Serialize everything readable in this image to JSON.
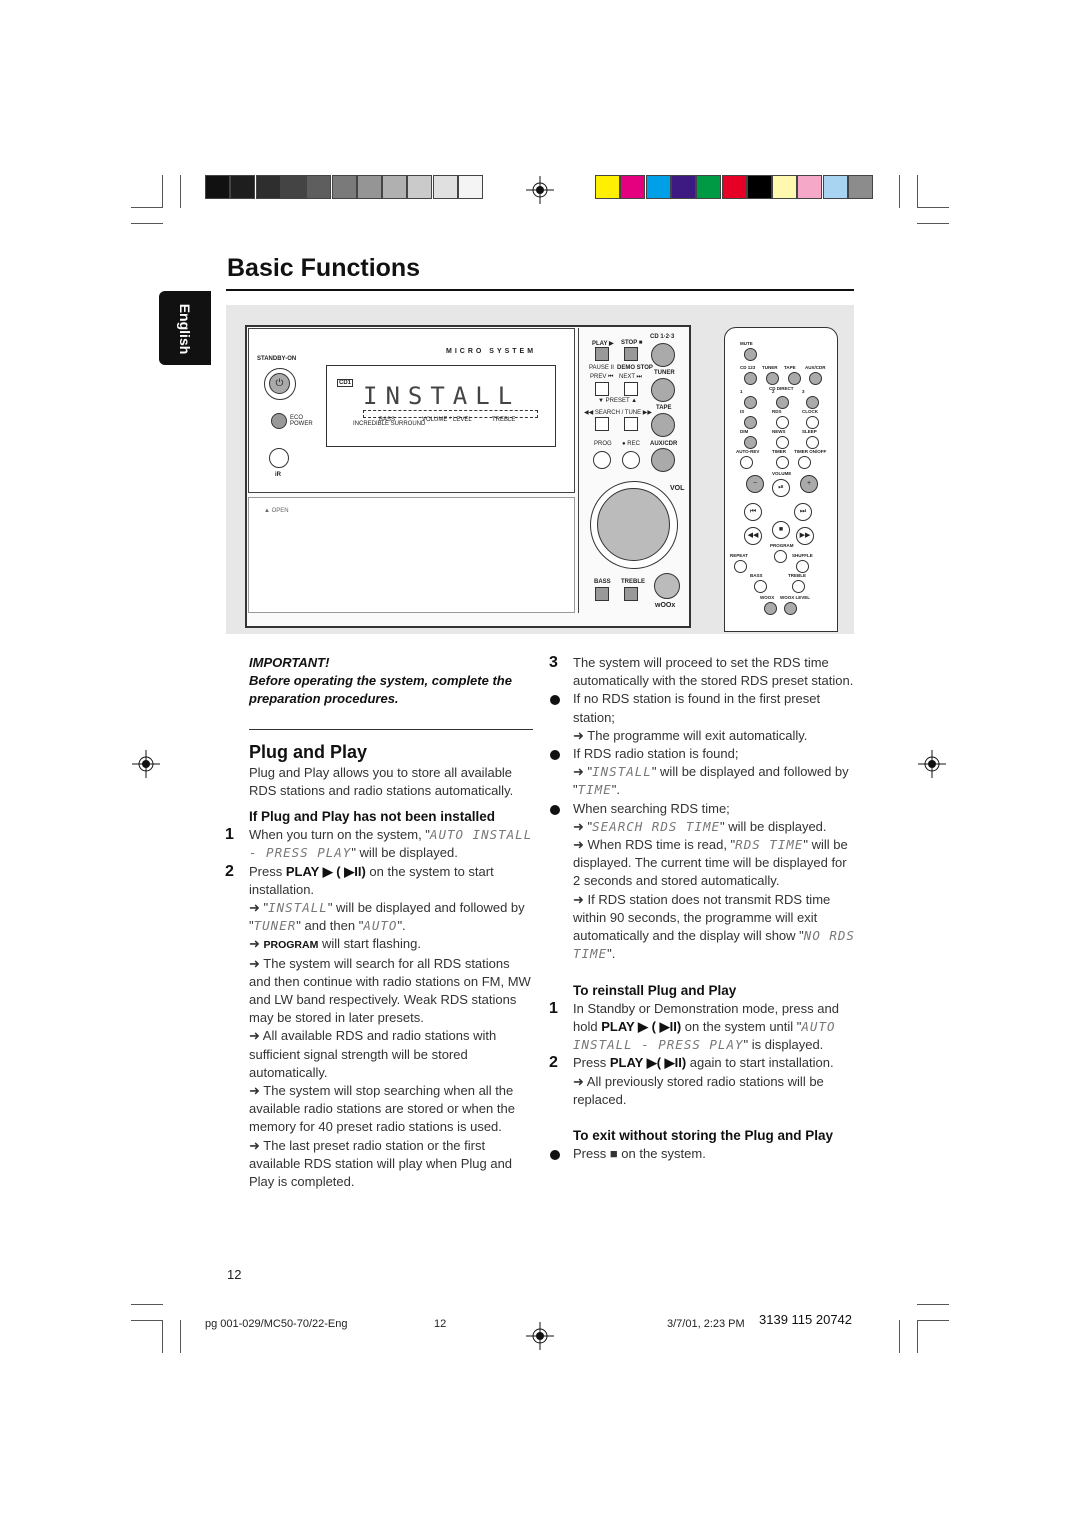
{
  "colors": {
    "grays": [
      "#111111",
      "#1e1e1e",
      "#2e2e2e",
      "#444444",
      "#5e5e5e",
      "#7a7a7a",
      "#959595",
      "#b0b0b0",
      "#cacaca",
      "#e0e0e0",
      "#f4f4f4"
    ],
    "process": [
      "#ffef00",
      "#e4007f",
      "#00a0e9",
      "#3c1a82",
      "#009944",
      "#e60026",
      "#000000",
      "#fff9b0",
      "#f5a8c8",
      "#a8d4f2",
      "#8c8c8c"
    ]
  },
  "page": {
    "title": "Basic Functions",
    "language_tab": "English",
    "page_number": "12"
  },
  "illustration": {
    "unit": {
      "brand_line": "MICRO SYSTEM",
      "standby": "STANDBY-ON",
      "eco": "ECO POWER",
      "ir": "iR",
      "open": "▲ OPEN",
      "display": {
        "text": "INSTALL",
        "cd": "CD1",
        "top_labels": [
          "OS",
          "DIM",
          "3",
          "FM",
          "CD",
          "RDS"
        ],
        "bass": "BASS",
        "surround": "INCREDIBLE SURROUND",
        "volume": "VOLUME * LEVEL",
        "treble": "TREBLE"
      },
      "controls": {
        "play": "PLAY ▶",
        "stop": "STOP ■",
        "cd123": "CD 1·2·3",
        "pause": "PAUSE II",
        "demo": "DEMO STOP",
        "tuner": "TUNER",
        "prev": "PREV ⏮",
        "next": "NEXT ⏭",
        "preset": "▼ PRESET ▲",
        "search": "◀◀ SEARCH / TUNE ▶▶",
        "tape": "TAPE",
        "prog": "PROG",
        "rec": "● REC",
        "aux": "AUX/CDR",
        "vol": "VOL",
        "bass": "BASS",
        "treble": "TREBLE",
        "woox": "wOOx"
      }
    },
    "remote": {
      "mute": "MUTE",
      "cd123": "CD 123",
      "tuner": "TUNER",
      "tape": "TAPE",
      "aux": "AUX/CDR",
      "cd_direct": "CD DIRECT",
      "n1": "1",
      "n2": "2",
      "n3": "3",
      "is": "IS",
      "rds": "RDS",
      "clock": "CLOCK",
      "dim": "DIM",
      "news": "NEWS",
      "sleep": "SLEEP",
      "autorev": "AUTO-REV",
      "timer": "TIMER",
      "timer_onoff": "TIMER ON/OFF",
      "volume": "VOLUME",
      "repeat": "REPEAT",
      "program": "PROGRAM",
      "shuffle": "SHUFFLE",
      "bass": "BASS",
      "treble": "TREBLE",
      "woox": "WOOX",
      "woox_level": "WOOX LEVEL"
    }
  },
  "left": [
    {
      "t": "p",
      "s": [
        [
          "bi",
          "IMPORTANT!"
        ]
      ]
    },
    {
      "t": "p",
      "s": [
        [
          "bi",
          "Before operating the system, complete the preparation procedures."
        ]
      ]
    },
    {
      "t": "rule"
    },
    {
      "t": "h2",
      "s": [
        [
          "n",
          "Plug and Play"
        ]
      ]
    },
    {
      "t": "p",
      "s": [
        [
          "n",
          "Plug and Play allows you to store all available RDS stations and radio stations automatically."
        ]
      ]
    },
    {
      "t": "h3",
      "s": [
        [
          "n",
          "If Plug and Play has not been installed"
        ]
      ]
    },
    {
      "t": "num",
      "n": "1",
      "s": [
        [
          "n",
          "When you turn on the system, \""
        ],
        [
          "lcd",
          "AUTO INSTALL - PRESS PLAY"
        ],
        [
          "n",
          "\" will be displayed."
        ]
      ]
    },
    {
      "t": "num",
      "n": "2",
      "s": [
        [
          "n",
          "Press "
        ],
        [
          "b",
          "PLAY ▶ ( ▶II)"
        ],
        [
          "n",
          " on the system to start installation."
        ]
      ]
    },
    {
      "t": "p",
      "s": [
        [
          "n",
          "➜ \""
        ],
        [
          "lcd",
          "INSTALL"
        ],
        [
          "n",
          "\" will be displayed and followed by \""
        ],
        [
          "lcd",
          "TUNER"
        ],
        [
          "n",
          "\" and then \""
        ],
        [
          "lcd",
          "AUTO"
        ],
        [
          "n",
          "\"."
        ]
      ]
    },
    {
      "t": "p",
      "s": [
        [
          "n",
          "➜ "
        ],
        [
          "sc",
          "PROGRAM"
        ],
        [
          "n",
          " will start flashing."
        ]
      ]
    },
    {
      "t": "p",
      "s": [
        [
          "n",
          "➜ The system will search for all RDS stations and then continue with radio stations on FM, MW and LW band respectively. Weak RDS stations may be stored in later presets."
        ]
      ]
    },
    {
      "t": "p",
      "s": [
        [
          "n",
          "➜ All available RDS and radio stations with sufficient signal strength will be stored automatically."
        ]
      ]
    },
    {
      "t": "p",
      "s": [
        [
          "n",
          "➜ The system will stop searching when all the available radio stations are stored or when the memory for 40 preset radio stations is used."
        ]
      ]
    },
    {
      "t": "p",
      "s": [
        [
          "n",
          "➜ The last preset radio station or the first available RDS station will play when Plug and Play is completed."
        ]
      ]
    }
  ],
  "right": [
    {
      "t": "num",
      "n": "3",
      "s": [
        [
          "n",
          "The system will proceed to set the RDS time automatically with the stored RDS preset station."
        ]
      ]
    },
    {
      "t": "bul",
      "s": [
        [
          "n",
          "If no RDS station is found in the first preset station;"
        ]
      ]
    },
    {
      "t": "p",
      "s": [
        [
          "n",
          "➜ The programme will exit automatically."
        ]
      ]
    },
    {
      "t": "bul",
      "s": [
        [
          "n",
          "If RDS radio station is found;"
        ]
      ]
    },
    {
      "t": "p",
      "s": [
        [
          "n",
          "➜ \""
        ],
        [
          "lcd",
          "INSTALL"
        ],
        [
          "n",
          "\" will be displayed and followed by \""
        ],
        [
          "lcd",
          "TIME"
        ],
        [
          "n",
          "\"."
        ]
      ]
    },
    {
      "t": "bul",
      "s": [
        [
          "n",
          "When searching RDS time;"
        ]
      ]
    },
    {
      "t": "p",
      "s": [
        [
          "n",
          "➜ \""
        ],
        [
          "lcd",
          "SEARCH RDS TIME"
        ],
        [
          "n",
          "\" will be displayed."
        ]
      ]
    },
    {
      "t": "p",
      "s": [
        [
          "n",
          "➜ When RDS time is read, \""
        ],
        [
          "lcd",
          "RDS TIME"
        ],
        [
          "n",
          "\" will be displayed. The current time will be displayed for 2 seconds and stored automatically."
        ]
      ]
    },
    {
      "t": "p",
      "s": [
        [
          "n",
          "➜ If RDS station does not transmit RDS time within 90 seconds, the programme will exit automatically and the display will show \""
        ],
        [
          "lcd",
          "NO RDS TIME"
        ],
        [
          "n",
          "\"."
        ]
      ]
    },
    {
      "t": "gap"
    },
    {
      "t": "h3",
      "s": [
        [
          "n",
          "To reinstall Plug and Play"
        ]
      ]
    },
    {
      "t": "num",
      "n": "1",
      "s": [
        [
          "n",
          "In Standby or Demonstration mode, press and hold "
        ],
        [
          "b",
          "PLAY ▶ ( ▶II)"
        ],
        [
          "n",
          " on the system until \""
        ],
        [
          "lcd",
          "AUTO INSTALL - PRESS PLAY"
        ],
        [
          "n",
          "\" is displayed."
        ]
      ]
    },
    {
      "t": "num",
      "n": "2",
      "s": [
        [
          "n",
          "Press "
        ],
        [
          "b",
          "PLAY ▶( ▶II)"
        ],
        [
          "n",
          " again to start installation."
        ]
      ]
    },
    {
      "t": "p",
      "s": [
        [
          "n",
          "➜ All previously stored radio stations will be replaced."
        ]
      ]
    },
    {
      "t": "gap"
    },
    {
      "t": "h3",
      "s": [
        [
          "n",
          "To exit without storing the Plug and Play"
        ]
      ]
    },
    {
      "t": "bul",
      "s": [
        [
          "n",
          "Press ■ on the system."
        ]
      ]
    }
  ],
  "footer": {
    "file": "pg 001-029/MC50-70/22-Eng",
    "page": "12",
    "date": "3/7/01, 2:23 PM",
    "code": "3139 115 20742"
  }
}
